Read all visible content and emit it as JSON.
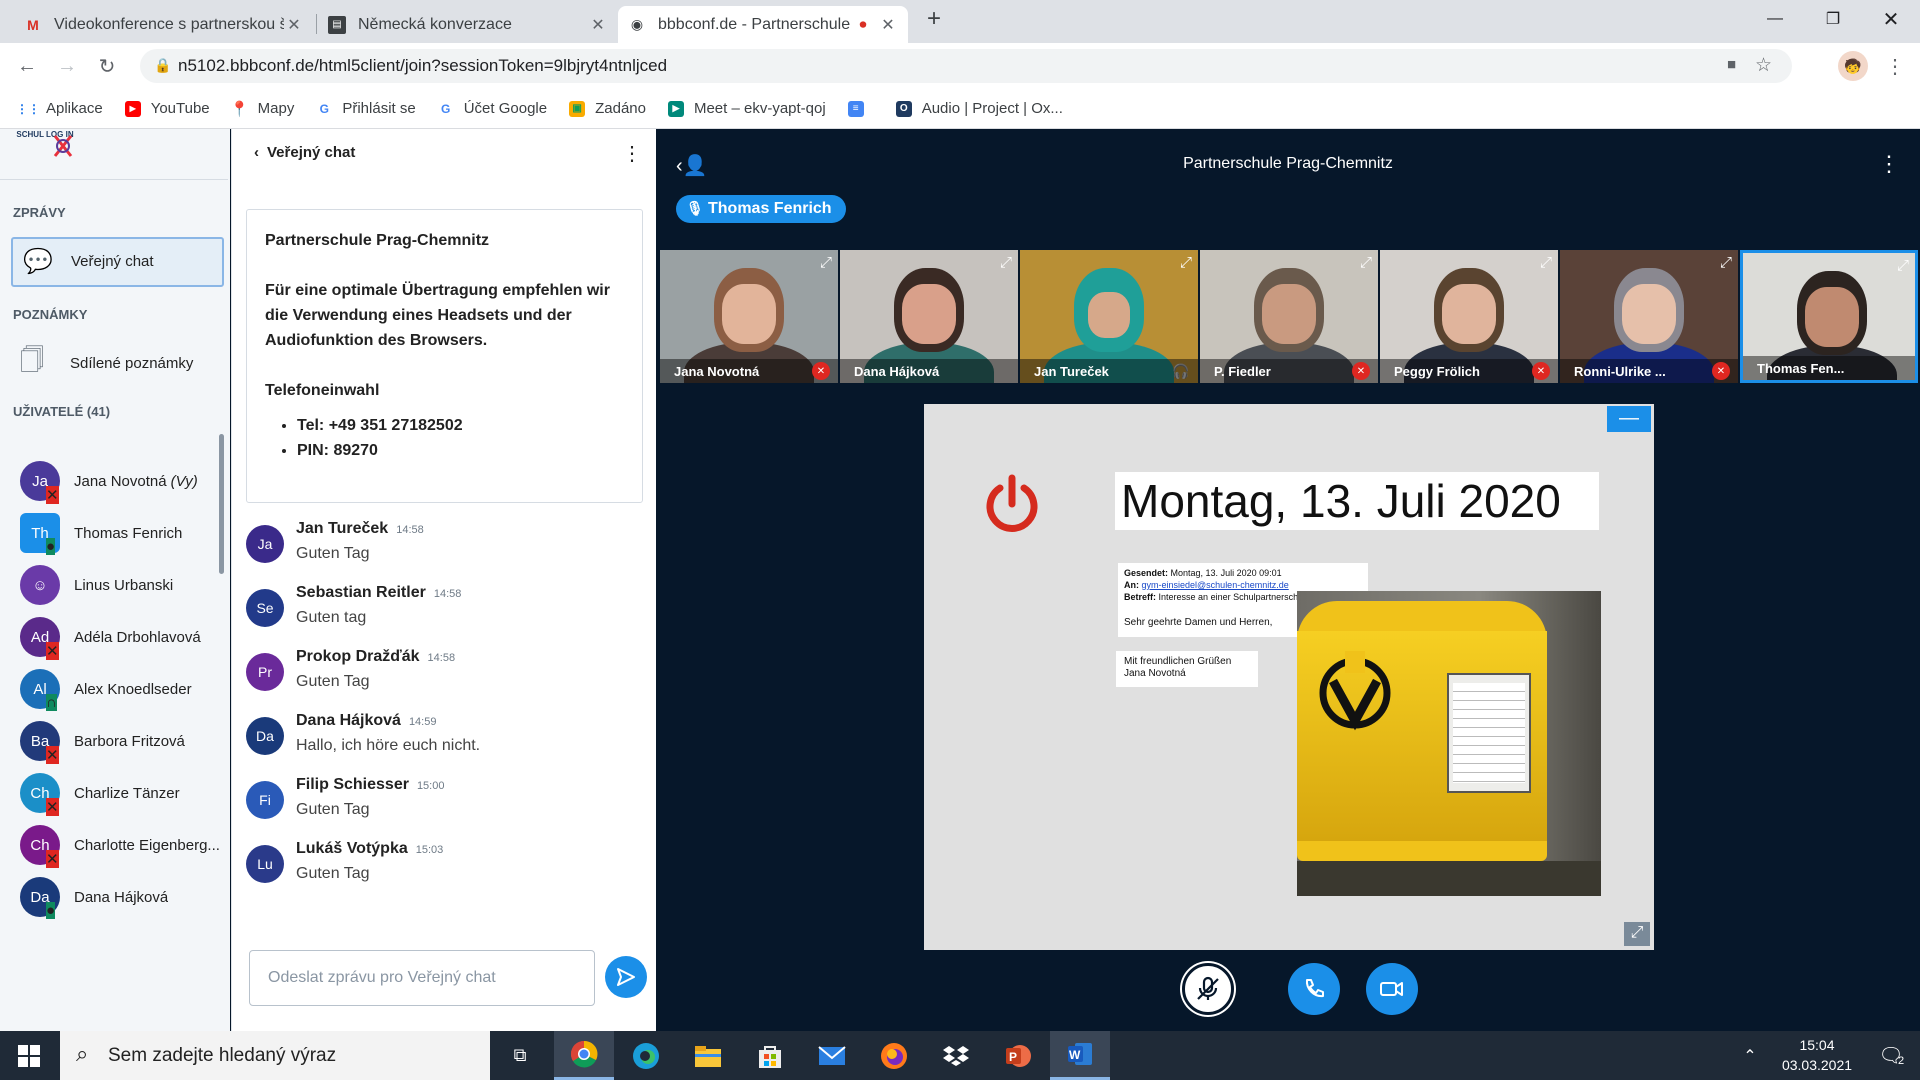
{
  "browser": {
    "tabs": [
      {
        "label": "Videokonference s partnerskou š",
        "icon": "gmail-icon"
      },
      {
        "label": "Německá konverzace",
        "icon": "classroom-icon"
      },
      {
        "label": "bbbconf.de - Partnerschule P",
        "icon": "bbb-icon"
      }
    ],
    "url": "n5102.bbbconf.de/html5client/join?sessionToken=9lbjryt4ntnljced",
    "bookmarks": [
      {
        "label": "Aplikace",
        "icon": "apps-grid-icon"
      },
      {
        "label": "YouTube",
        "icon": "youtube-icon"
      },
      {
        "label": "Mapy",
        "icon": "maps-icon"
      },
      {
        "label": "Přihlásit se",
        "icon": "google-icon"
      },
      {
        "label": "Účet Google",
        "icon": "google-icon"
      },
      {
        "label": "Zadáno",
        "icon": "classroom-icon"
      },
      {
        "label": "Meet – ekv-yapt-qoj",
        "icon": "meet-icon"
      },
      {
        "label": "",
        "icon": "docs-icon"
      },
      {
        "label": "Audio | Project | Ox...",
        "icon": "ox-icon"
      }
    ]
  },
  "sidebar": {
    "logo_text": "SCHUL LOG IN",
    "messages_heading": "ZPRÁVY",
    "public_chat": "Veřejný chat",
    "notes_heading": "POZNÁMKY",
    "shared_notes": "Sdílené poznámky",
    "users_heading": "UŽIVATELÉ (41)",
    "users": [
      {
        "initials": "Ja",
        "name": "Jana Novotná",
        "suffix": "(Vy)",
        "color": "#4A3A9A",
        "status": "muted"
      },
      {
        "initials": "Th",
        "name": "Thomas Fenrich",
        "suffix": "",
        "color": "#1B8FE8",
        "status": "talking",
        "presenter": true
      },
      {
        "initials": "☺",
        "name": "Linus Urbanski",
        "suffix": "",
        "color": "#6A3AA8",
        "status": "none"
      },
      {
        "initials": "Ad",
        "name": "Adéla Drbohlavová",
        "suffix": "",
        "color": "#5A2A8A",
        "status": "muted"
      },
      {
        "initials": "Al",
        "name": "Alex Knoedlseder",
        "suffix": "",
        "color": "#1B6FB8",
        "status": "listen"
      },
      {
        "initials": "Ba",
        "name": "Barbora Fritzová",
        "suffix": "",
        "color": "#223A7A",
        "status": "muted"
      },
      {
        "initials": "Ch",
        "name": "Charlize Tänzer",
        "suffix": "",
        "color": "#1B8FC8",
        "status": "muted"
      },
      {
        "initials": "Ch",
        "name": "Charlotte Eigenberg...",
        "suffix": "",
        "color": "#7A1A8A",
        "status": "muted"
      },
      {
        "initials": "Da",
        "name": "Dana Hájková",
        "suffix": "",
        "color": "#1A3A7A",
        "status": "talking"
      }
    ]
  },
  "chat": {
    "title": "Veřejný chat",
    "welcome": {
      "heading": "Partnerschule Prag-Chemnitz",
      "body": "Für eine optimale Übertragung empfehlen wir die Verwendung eines Headsets und der Audiofunktion des Browsers.",
      "phone_heading": "Telefoneinwahl",
      "tel": "Tel: +49 351 27182502",
      "pin": "PIN: 89270"
    },
    "messages": [
      {
        "initials": "Ja",
        "name": "Jan Tureček",
        "time": "14:58",
        "text": "Guten Tag",
        "color": "#3A2A8A"
      },
      {
        "initials": "Se",
        "name": "Sebastian Reitler",
        "time": "14:58",
        "text": "Guten tag",
        "color": "#223A8A"
      },
      {
        "initials": "Pr",
        "name": "Prokop Dražďák",
        "time": "14:58",
        "text": "Guten Tag",
        "color": "#6A2A9A"
      },
      {
        "initials": "Da",
        "name": "Dana Hájková",
        "time": "14:59",
        "text": "Hallo, ich höre euch nicht.",
        "color": "#1A3A7A"
      },
      {
        "initials": "Fi",
        "name": "Filip Schiesser",
        "time": "15:00",
        "text": "Guten Tag",
        "color": "#2A5AB8"
      },
      {
        "initials": "Lu",
        "name": "Lukáš Votýpka",
        "time": "15:03",
        "text": "Guten Tag",
        "color": "#2A3A8A"
      }
    ],
    "input_placeholder": "Odeslat zprávu pro Veřejný chat"
  },
  "meeting": {
    "title": "Partnerschule Prag-Chemnitz",
    "talking": "Thomas Fenrich",
    "cameras": [
      {
        "name": "Jana Novotná",
        "mic": "muted"
      },
      {
        "name": "Dana Hájková",
        "mic": "none"
      },
      {
        "name": "Jan Tureček",
        "mic": "headphones"
      },
      {
        "name": "P. Fiedler",
        "mic": "muted"
      },
      {
        "name": "Peggy Frölich",
        "mic": "muted"
      },
      {
        "name": "Ronni-Ulrike ...",
        "mic": "muted"
      },
      {
        "name": "Thomas Fen...",
        "mic": "none"
      }
    ],
    "slide": {
      "date": "Montag, 13. Juli 2020",
      "email_sent_label": "Gesendet:",
      "email_sent": "Montag, 13. Juli 2020 09:01",
      "email_to_label": "An:",
      "email_to": "gym-einsiedel@schulen-chemnitz.de",
      "email_subject_label": "Betreff:",
      "email_subject": "Interesse an einer Schulpartnerschaft",
      "email_greeting": "Sehr geehrte Damen und Herren,",
      "closing": "Mit freundlichen Grüßen",
      "closing_name": "Jana Novotná"
    }
  },
  "taskbar": {
    "search_placeholder": "Sem zadejte hledaný výraz",
    "time": "15:04",
    "date": "03.03.2021",
    "notifications": "2"
  }
}
